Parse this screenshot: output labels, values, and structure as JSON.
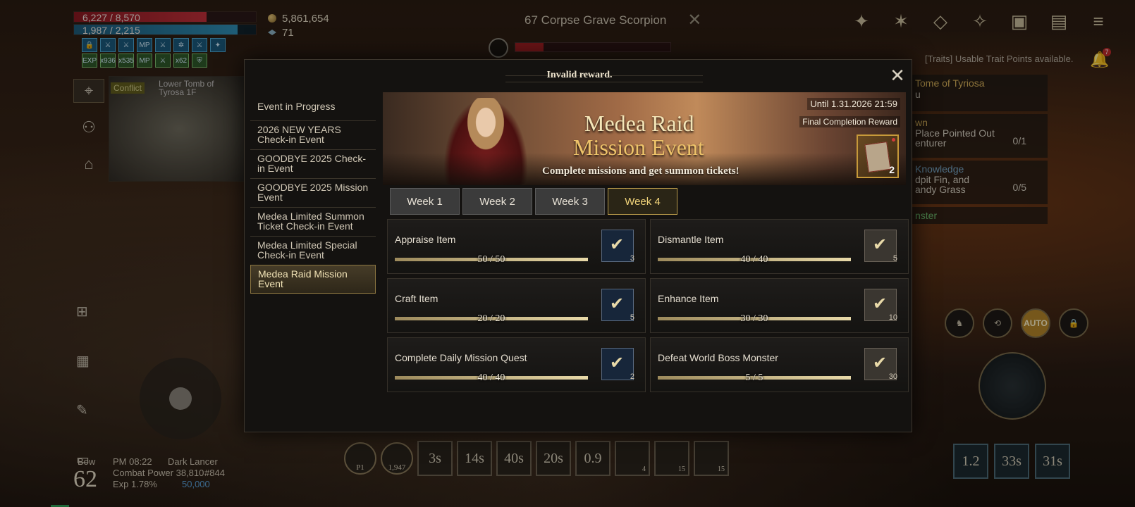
{
  "hud": {
    "hp": "6,227 / 8,570",
    "hp_fraction": 0.73,
    "mp": "1,987 / 2,215",
    "mp_fraction": 0.9,
    "gold": "5,861,654",
    "gems": "71",
    "buff_labels": [
      "🔒",
      "⚔",
      "⚔",
      "MP",
      "⚔",
      "✲",
      "⚔",
      "✦",
      "EXP",
      "x936",
      "x535",
      "MP",
      "⚔",
      "x62",
      "⛨"
    ]
  },
  "target": {
    "name": "67 Corpse Grave Scorpion",
    "close": "✕",
    "hp_fraction": 0.18
  },
  "top_icons": [
    "emblem-icon",
    "star-icon",
    "diamond-icon",
    "compass-icon",
    "cards-icon",
    "chest-icon",
    "menu-icon"
  ],
  "notice": {
    "trait": "[Traits] Usable Trait Points available.",
    "bell_count": "7"
  },
  "minimap": {
    "conflict": "Conflict",
    "location": "Lower Tomb of Tyrosa 1F"
  },
  "tracker": {
    "rows": [
      {
        "title": "Tome of Tyriosa",
        "sub": "u"
      },
      {
        "title": "wn",
        "sub": "Place Pointed Out\nenturer",
        "count": "0/1"
      },
      {
        "title": "Knowledge",
        "sub": "dpit Fin, and\nandy Grass",
        "count": "0/5"
      },
      {
        "title": "nster"
      }
    ]
  },
  "character": {
    "class_short": "Bow",
    "level": "62",
    "time": "PM 08:22",
    "class_name": "Dark Lancer",
    "combat_power": "Combat Power 38,810",
    "rank": "#844",
    "exp": "Exp 1.78%",
    "exp_value": "50,000"
  },
  "skillbar": {
    "slots": [
      {
        "label": "P1",
        "kind": "pot"
      },
      {
        "label": "1,947",
        "kind": "pot"
      },
      {
        "label": "3s"
      },
      {
        "label": "14s"
      },
      {
        "label": "40s"
      },
      {
        "label": "20s"
      },
      {
        "label": "0.9"
      },
      {
        "label": "",
        "count": "4"
      },
      {
        "label": "",
        "count": "15"
      },
      {
        "label": "",
        "count": "15"
      }
    ]
  },
  "right_skills": [
    "1.2",
    "33s",
    "31s"
  ],
  "auto_label": "AUTO",
  "modal": {
    "title": "Invalid reward.",
    "close": "✕",
    "event_list_heading": "Event in Progress",
    "events": [
      "2026 NEW YEARS Check-in Event",
      "GOODBYE 2025 Check-in Event",
      "GOODBYE 2025 Mission Event",
      "Medea Limited Summon Ticket Check-in Event",
      "Medea Limited Special Check-in Event",
      "Medea Raid Mission Event"
    ],
    "active_event_index": 5,
    "banner": {
      "title_line1": "Medea Raid",
      "title_line2": "Mission Event",
      "subtitle": "Complete missions and get summon tickets!",
      "until": "Until 1.31.2026 21:59",
      "final_reward_label": "Final Completion Reward",
      "final_reward_qty": "2"
    },
    "tabs": [
      "Week 1",
      "Week 2",
      "Week 3",
      "Week 4"
    ],
    "active_tab": 3,
    "missions": [
      {
        "name": "Appraise Item",
        "progress": "50 / 50",
        "fraction": 1.0,
        "reward_qty": "3"
      },
      {
        "name": "Dismantle Item",
        "progress": "40 / 40",
        "fraction": 1.0,
        "reward_qty": "5"
      },
      {
        "name": "Craft Item",
        "progress": "20 / 20",
        "fraction": 1.0,
        "reward_qty": "5"
      },
      {
        "name": "Enhance Item",
        "progress": "30 / 30",
        "fraction": 1.0,
        "reward_qty": "10"
      },
      {
        "name": "Complete Daily Mission Quest",
        "progress": "40 / 40",
        "fraction": 1.0,
        "reward_qty": "2"
      },
      {
        "name": "Defeat World Boss Monster",
        "progress": "5 / 5",
        "fraction": 1.0,
        "reward_qty": "30"
      }
    ]
  }
}
